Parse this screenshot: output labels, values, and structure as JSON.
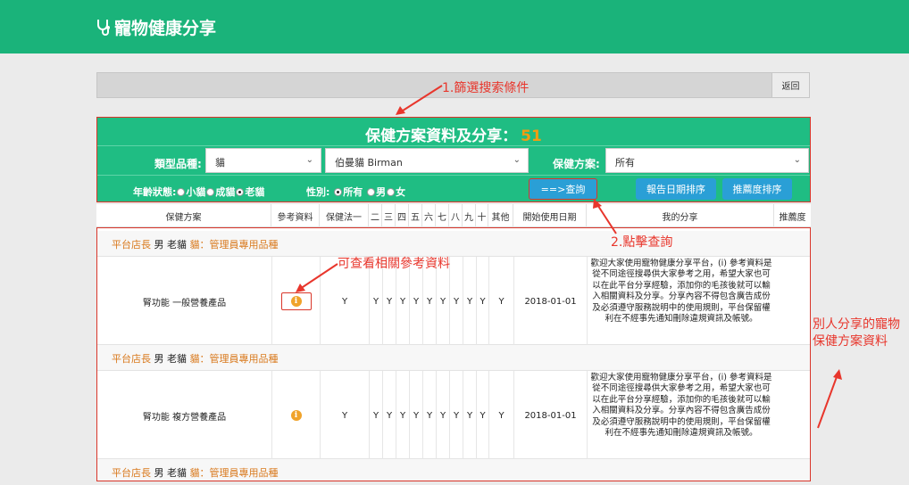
{
  "app": {
    "title": "寵物健康分享"
  },
  "filterbar": {
    "back_label": "返回"
  },
  "panel": {
    "title": "保健方案資料及分享：",
    "count": "51",
    "type_label": "類型品種:",
    "type_value": "貓",
    "breed_value": "伯曼貓 Birman",
    "plan_label": "保健方案:",
    "plan_value": "所有",
    "age_label": "年齡狀態:",
    "age_options": [
      "小貓",
      "成貓",
      "老貓"
    ],
    "gender_label": "性別:",
    "gender_options": [
      "所有",
      "男",
      "女"
    ],
    "query_button": "==>查詢",
    "sort_date_button": "報告日期排序",
    "sort_rec_button": "推薦度排序"
  },
  "table": {
    "headers": [
      "保健方案",
      "參考資料",
      "保健法一",
      "二",
      "三",
      "四",
      "五",
      "六",
      "七",
      "八",
      "九",
      "十",
      "其他",
      "開始使用日期",
      "我的分享",
      "推薦度"
    ],
    "record_header": {
      "role": "平台店長",
      "gender": "男",
      "age": "老貓",
      "breed_note": "貓：管理員專用品種"
    },
    "rows": [
      {
        "plan": "腎功能 一般營養產品",
        "method1": "Y",
        "methods": [
          "Y",
          "Y",
          "Y",
          "Y",
          "Y",
          "Y",
          "Y",
          "Y",
          "Y"
        ],
        "other": "Y",
        "start_date": "2018-01-01",
        "share": "歡迎大家使用寵物健康分享平台，(i) 參考資料是從不同途徑搜尋供大家參考之用，希望大家也可以在此平台分享經驗，添加你的毛孩後就可以輸入相關資料及分享。分享內容不得包含廣告成份及必須遵守服務說明中的使用規則，平台保留權利在不經事先通知刪除違規資訊及帳號。"
      },
      {
        "plan": "腎功能 複方營養產品",
        "method1": "Y",
        "methods": [
          "Y",
          "Y",
          "Y",
          "Y",
          "Y",
          "Y",
          "Y",
          "Y",
          "Y"
        ],
        "other": "Y",
        "start_date": "2018-01-01",
        "share": "歡迎大家使用寵物健康分享平台，(i) 參考資料是從不同途徑搜尋供大家參考之用，希望大家也可以在此平台分享經驗，添加你的毛孩後就可以輸入相關資料及分享。分享內容不得包含廣告成份及必須遵守服務說明中的使用規則，平台保留權利在不經事先通知刪除違規資訊及帳號。"
      }
    ]
  },
  "annotations": {
    "step1": "1.篩選搜索條件",
    "step2": "2.點擊查詢",
    "ref": "可查看相關參考資料",
    "others_share": "別人分享的寵物保健方案資料"
  },
  "colors": {
    "header_green": "#1ab37a",
    "panel_green": "#1fbd83",
    "button_blue": "#2a9fd6",
    "annotation_red": "#e8362c",
    "orange": "#d97a1e"
  }
}
